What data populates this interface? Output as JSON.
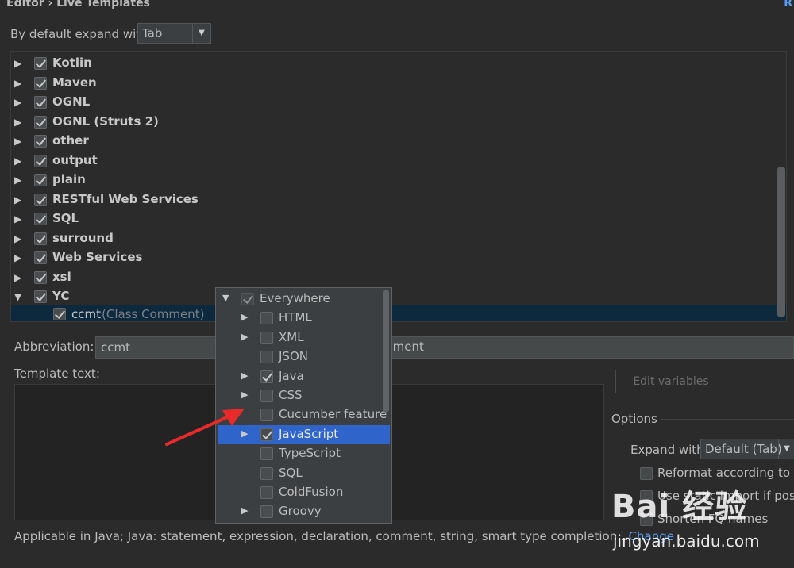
{
  "header": {
    "breadcrumb": "Editor › Live Templates",
    "reset_link": "R"
  },
  "expand": {
    "label": "By default expand with",
    "value": "Tab"
  },
  "tree": {
    "groups": [
      {
        "label": "Kotlin",
        "checked": true,
        "expanded": false
      },
      {
        "label": "Maven",
        "checked": true,
        "expanded": false
      },
      {
        "label": "OGNL",
        "checked": true,
        "expanded": false
      },
      {
        "label": "OGNL (Struts 2)",
        "checked": true,
        "expanded": false
      },
      {
        "label": "other",
        "checked": true,
        "expanded": false
      },
      {
        "label": "output",
        "checked": true,
        "expanded": false
      },
      {
        "label": "plain",
        "checked": true,
        "expanded": false
      },
      {
        "label": "RESTful Web Services",
        "checked": true,
        "expanded": false
      },
      {
        "label": "SQL",
        "checked": true,
        "expanded": false
      },
      {
        "label": "surround",
        "checked": true,
        "expanded": false
      },
      {
        "label": "Web Services",
        "checked": true,
        "expanded": false
      },
      {
        "label": "xsl",
        "checked": true,
        "expanded": false
      },
      {
        "label": "YC",
        "checked": true,
        "expanded": true
      }
    ],
    "child": {
      "abbr": "ccmt",
      "desc": "(Class Comment)"
    }
  },
  "form": {
    "abbr_label": "Abbreviation:",
    "abbr_value": "ccmt",
    "desc_value": "mment",
    "template_label": "Template text:",
    "edit_vars": "Edit variables",
    "options_label": "Options",
    "expand_with_label": "Expand with",
    "expand_with_value": "Default (Tab)",
    "opt1": "Reformat according to sty",
    "opt2": "Use static import if possib",
    "opt3": "Shorten FQ names",
    "applicable": "Applicable in Java; Java: statement, expression, declaration, comment, string, smart type completion...",
    "change": "Change"
  },
  "popup": {
    "items": [
      {
        "label": "Everywhere",
        "checked": true,
        "arrow": "down",
        "level": 0,
        "selected": false
      },
      {
        "label": "HTML",
        "checked": false,
        "arrow": "right",
        "level": 1,
        "selected": false
      },
      {
        "label": "XML",
        "checked": false,
        "arrow": "right",
        "level": 1,
        "selected": false
      },
      {
        "label": "JSON",
        "checked": false,
        "arrow": "",
        "level": 1,
        "selected": false
      },
      {
        "label": "Java",
        "checked": true,
        "arrow": "right",
        "level": 1,
        "selected": false
      },
      {
        "label": "CSS",
        "checked": false,
        "arrow": "right",
        "level": 1,
        "selected": false
      },
      {
        "label": "Cucumber feature",
        "checked": false,
        "arrow": "",
        "level": 1,
        "selected": false
      },
      {
        "label": "JavaScript",
        "checked": true,
        "arrow": "right",
        "level": 1,
        "selected": true
      },
      {
        "label": "TypeScript",
        "checked": false,
        "arrow": "",
        "level": 1,
        "selected": false
      },
      {
        "label": "SQL",
        "checked": false,
        "arrow": "",
        "level": 1,
        "selected": false
      },
      {
        "label": "ColdFusion",
        "checked": false,
        "arrow": "",
        "level": 1,
        "selected": false
      },
      {
        "label": "Groovy",
        "checked": false,
        "arrow": "right",
        "level": 1,
        "selected": false
      }
    ]
  },
  "watermark": {
    "logo": "Bai 经验",
    "url": "jingyan.baidu.com"
  },
  "colors": {
    "accent": "#2f65ca",
    "link": "#589df6",
    "arrow": "#e82a2a"
  }
}
